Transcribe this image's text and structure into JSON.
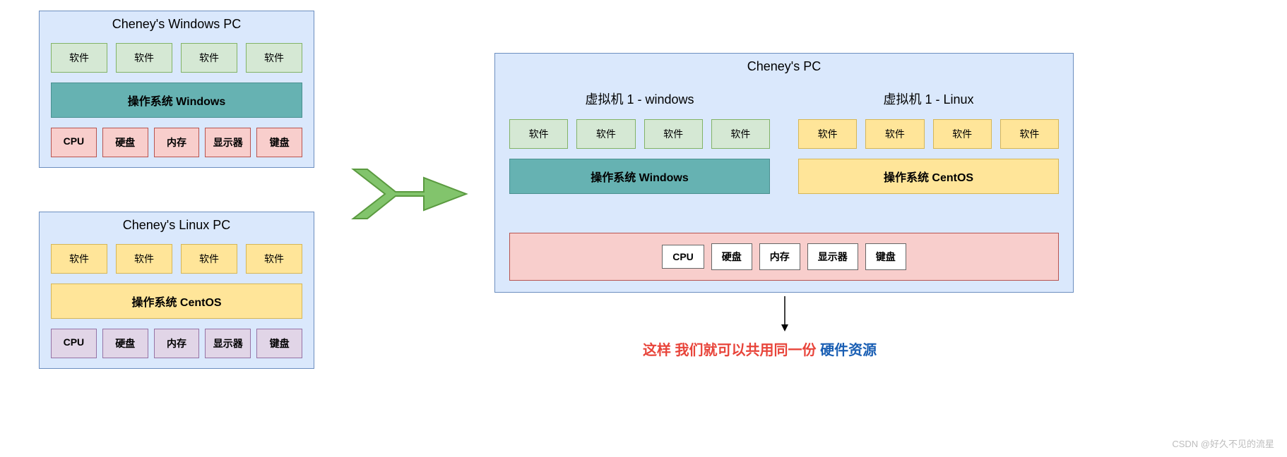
{
  "left_windows": {
    "title": "Cheney's Windows PC",
    "software": [
      "软件",
      "软件",
      "软件",
      "软件"
    ],
    "os": "操作系统 Windows",
    "hardware": [
      "CPU",
      "硬盘",
      "内存",
      "显示器",
      "键盘"
    ]
  },
  "left_linux": {
    "title": "Cheney's Linux PC",
    "software": [
      "软件",
      "软件",
      "软件",
      "软件"
    ],
    "os": "操作系统 CentOS",
    "hardware": [
      "CPU",
      "硬盘",
      "内存",
      "显示器",
      "键盘"
    ]
  },
  "right_pc": {
    "title": "Cheney's PC",
    "vm1": {
      "title": "虚拟机 1 - windows",
      "software": [
        "软件",
        "软件",
        "软件",
        "软件"
      ],
      "os": "操作系统 Windows"
    },
    "vm2": {
      "title": "虚拟机 1 - Linux",
      "software": [
        "软件",
        "软件",
        "软件",
        "软件"
      ],
      "os": "操作系统 CentOS"
    },
    "shared_hardware": [
      "CPU",
      "硬盘",
      "内存",
      "显示器",
      "键盘"
    ]
  },
  "caption": {
    "part1": "这样 我们就可以共用同一份",
    "part2": "硬件资源"
  },
  "watermark": "CSDN @好久不见的流星"
}
